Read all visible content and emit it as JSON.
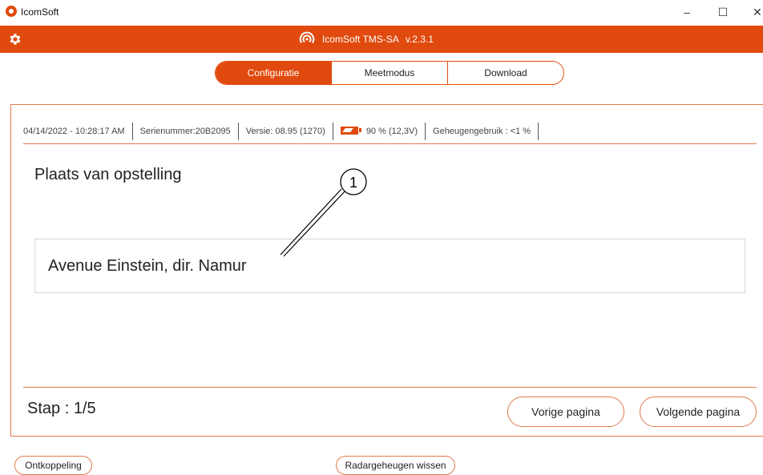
{
  "window": {
    "title": "IcomSoft",
    "minimize": "–",
    "maximize": "☐",
    "close": "✕"
  },
  "header": {
    "brand_name": "IcomSoft TMS-SA",
    "version": "v.2.3.1",
    "accent_color": "#e04a0e"
  },
  "tabs": [
    {
      "label": "Configuratie",
      "active": true
    },
    {
      "label": "Meetmodus",
      "active": false
    },
    {
      "label": "Download",
      "active": false
    }
  ],
  "status": {
    "datetime": "04/14/2022 - 10:28:17 AM",
    "serial": "Serienummer:20B2095",
    "version": "Versie: 08.95 (1270)",
    "battery": "90 %  (12,3V)",
    "memory": "Geheugengebruik : <1 %"
  },
  "main": {
    "heading": "Plaats van opstelling",
    "location_value": "Avenue Einstein, dir. Namur",
    "callout_number": "1"
  },
  "footer": {
    "step": "Stap : 1/5",
    "prev_label": "Vorige pagina",
    "next_label": "Volgende pagina"
  },
  "bottom": {
    "disconnect_label": "Ontkoppeling",
    "clear_memory_label": "Radargeheugen wissen"
  }
}
